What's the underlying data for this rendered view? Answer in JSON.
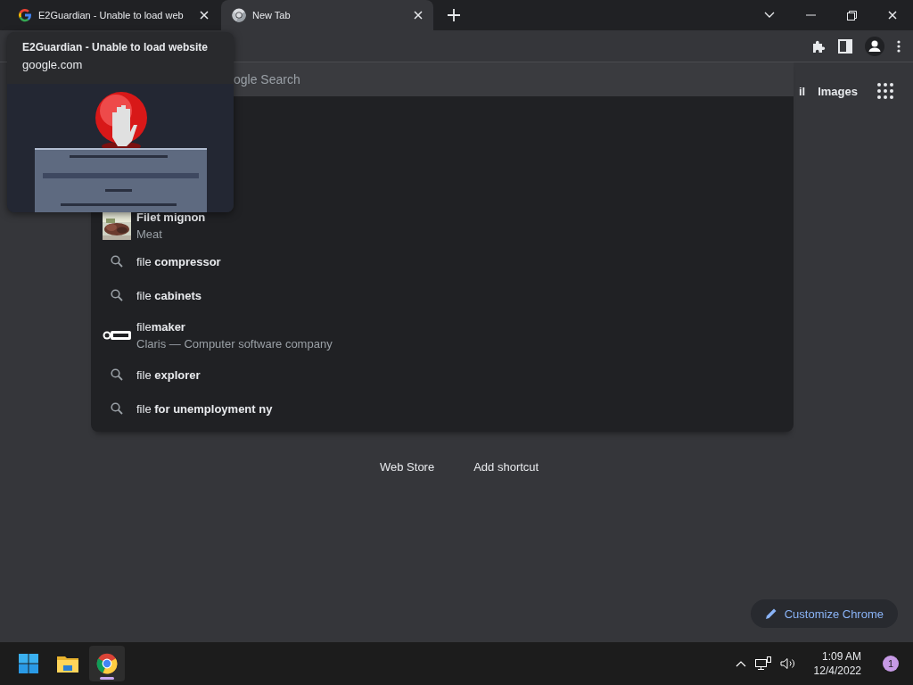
{
  "tabs": [
    {
      "title": "E2Guardian - Unable to load web",
      "kind": "google",
      "selected": false
    },
    {
      "title": "New Tab",
      "kind": "chrome",
      "selected": true
    }
  ],
  "hover_card": {
    "title": "E2Guardian - Unable to load website",
    "domain": "google.com"
  },
  "header_links": [
    "il",
    "Images"
  ],
  "search": {
    "placeholder": "ogle Search"
  },
  "suggestions": [
    {
      "kind": "entity",
      "text": "Filet mignon",
      "subtitle": "Meat"
    },
    {
      "kind": "search",
      "text": "file **compressor**"
    },
    {
      "kind": "search",
      "text": "file **cabinets**"
    },
    {
      "kind": "brand",
      "text": "file**maker**",
      "subtitle": "Claris — Computer software company"
    },
    {
      "kind": "search",
      "text": "file **explorer**"
    },
    {
      "kind": "search",
      "text": "file **for unemployment ny**"
    }
  ],
  "shortcuts": [
    "Web Store",
    "Add shortcut"
  ],
  "customize_button": "Customize Chrome",
  "taskbar": {
    "apps": [
      {
        "kind": "start",
        "selected": false
      },
      {
        "kind": "explorer",
        "selected": false
      },
      {
        "kind": "chrome",
        "selected": true
      }
    ],
    "time": "1:09 AM",
    "date": "12/4/2022",
    "notifications": "1"
  }
}
